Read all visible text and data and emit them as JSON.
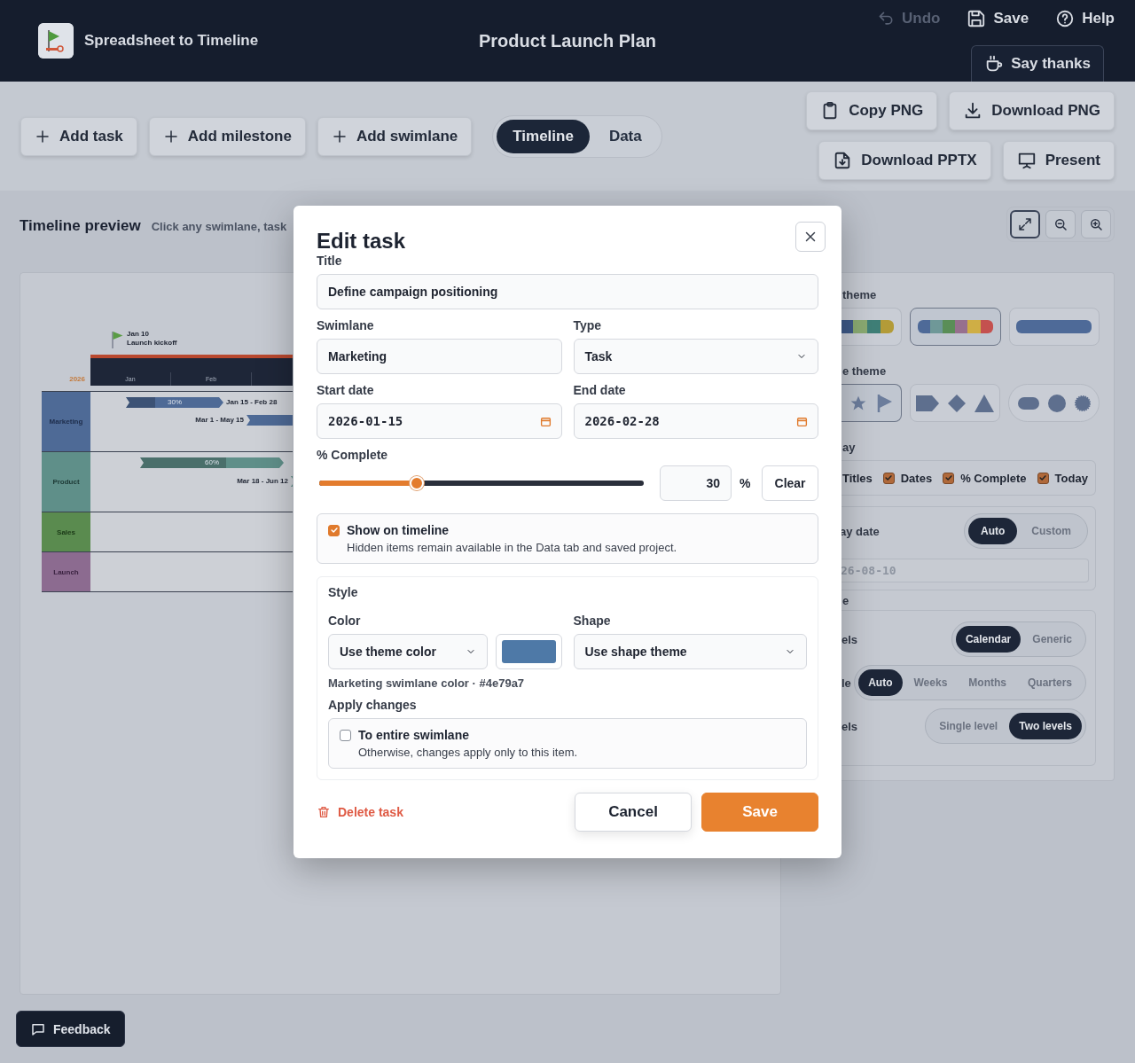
{
  "header": {
    "app_name": "Spreadsheet to Timeline",
    "document_title": "Product Launch Plan",
    "actions": [
      {
        "kind": "undo",
        "label": "Undo",
        "disabled": true
      },
      {
        "kind": "save",
        "label": "Save",
        "disabled": false
      },
      {
        "kind": "help",
        "label": "Help",
        "disabled": false
      }
    ],
    "say_thanks": "Say thanks"
  },
  "toolbar": {
    "add_buttons": [
      {
        "label": "Add task"
      },
      {
        "label": "Add milestone"
      },
      {
        "label": "Add swimlane"
      }
    ],
    "view_tabs": [
      {
        "label": "Timeline",
        "selected": true
      },
      {
        "label": "Data",
        "selected": false
      }
    ],
    "export_buttons": [
      {
        "kind": "copy",
        "label": "Copy PNG"
      },
      {
        "kind": "download",
        "label": "Download PNG"
      },
      {
        "kind": "file",
        "label": "Download PPTX"
      },
      {
        "kind": "present",
        "label": "Present"
      }
    ]
  },
  "preview": {
    "title": "Timeline preview",
    "hint": "Click any swimlane, task",
    "zoom_buttons": [
      {
        "kind": "fit",
        "selected": true
      },
      {
        "kind": "zoom-out",
        "selected": false
      },
      {
        "kind": "zoom-in",
        "selected": false
      }
    ]
  },
  "timeline": {
    "year": "2026",
    "months": [
      "Jan",
      "Feb"
    ],
    "milestone": {
      "date": "Jan 10",
      "label": "Launch kickoff"
    },
    "swimlanes": [
      {
        "name": "Marketing",
        "color": "#4e6a96",
        "tasks": [
          {
            "progress": "30%",
            "level": 0.3,
            "dates": "Jan 15 - Feb 28"
          },
          {
            "dates": "Mar 1 - May 15"
          }
        ]
      },
      {
        "name": "Product",
        "color": "#5f8f89",
        "tasks": [
          {
            "progress": "60%",
            "level": 0.6
          },
          {
            "dates": "Mar 18 - Jun 12"
          }
        ]
      },
      {
        "name": "Sales",
        "color": "#5a8b4f"
      },
      {
        "name": "Launch",
        "color": "#8c6b90"
      }
    ]
  },
  "settings": {
    "color_theme_label": "theme",
    "color_themes": [
      {
        "selected": false,
        "swatches": [
          {
            "color": "#3e5a88"
          },
          {
            "color": "#8aaa72"
          },
          {
            "color": "#3f7f77"
          },
          {
            "color": "#b39b38"
          }
        ]
      },
      {
        "selected": true,
        "swatches": [
          {
            "color": "#4e6a98"
          },
          {
            "color": "#6f9898"
          },
          {
            "color": "#5a8e57"
          },
          {
            "color": "#97708e"
          },
          {
            "color": "#cfae45"
          },
          {
            "color": "#c4514f"
          }
        ]
      },
      {
        "selected": false,
        "swatches": [
          {
            "color": "#4e6a98"
          }
        ]
      }
    ],
    "shape_theme_label": "e theme",
    "shape_themes": [
      {
        "kind": "milestone",
        "selected": true
      },
      {
        "kind": "angular",
        "selected": false
      },
      {
        "kind": "round",
        "selected": false
      }
    ],
    "display_label": "ay",
    "display_options": [
      {
        "label": "Titles"
      },
      {
        "label": "Dates",
        "checked": true
      },
      {
        "label": "% Complete",
        "checked": true
      },
      {
        "label": "Today",
        "checked": true
      }
    ],
    "today": {
      "label": "ay date",
      "options": [
        {
          "label": "Auto",
          "selected": true
        },
        {
          "label": "Custom",
          "selected": false
        }
      ],
      "value": "26-08-10"
    },
    "scale_heading": "e",
    "scale_rows": [
      {
        "label": "els",
        "options": [
          {
            "label": "Calendar",
            "selected": true
          },
          {
            "label": "Generic",
            "selected": false
          }
        ]
      },
      {
        "label": "le",
        "options": [
          {
            "label": "Auto",
            "selected": true
          },
          {
            "label": "Weeks",
            "selected": false
          },
          {
            "label": "Months",
            "selected": false
          },
          {
            "label": "Quarters",
            "selected": false
          }
        ]
      },
      {
        "label": "els",
        "options": [
          {
            "label": "Single level",
            "selected": false
          },
          {
            "label": "Two levels",
            "selected": true
          }
        ]
      }
    ]
  },
  "edit_task": {
    "heading": "Edit task",
    "title_label": "Title",
    "title_value": "Define campaign positioning",
    "swimlane_label": "Swimlane",
    "swimlane_value": "Marketing",
    "type_label": "Type",
    "type_value": "Task",
    "start_label": "Start date",
    "start_value": "2026-01-15",
    "end_label": "End date",
    "end_value": "2026-02-28",
    "complete_label": "% Complete",
    "complete": {
      "level": 0.3,
      "value": "30",
      "unit": "%",
      "clear": "Clear"
    },
    "show_on_timeline": {
      "label": "Show on timeline",
      "hint": "Hidden items remain available in the Data tab and saved project.",
      "checked": true
    },
    "style": {
      "heading": "Style",
      "color_label": "Color",
      "color_select": "Use theme color",
      "color": "#4e79a7",
      "shape_label": "Shape",
      "shape_select": "Use shape theme",
      "color_hint": "Marketing swimlane color · #4e79a7",
      "apply_label": "Apply changes",
      "apply": {
        "label": "To entire swimlane",
        "hint": "Otherwise, changes apply only to this item.",
        "checked": false
      }
    },
    "delete": "Delete task",
    "cancel": "Cancel",
    "save": "Save"
  },
  "feedback": "Feedback"
}
